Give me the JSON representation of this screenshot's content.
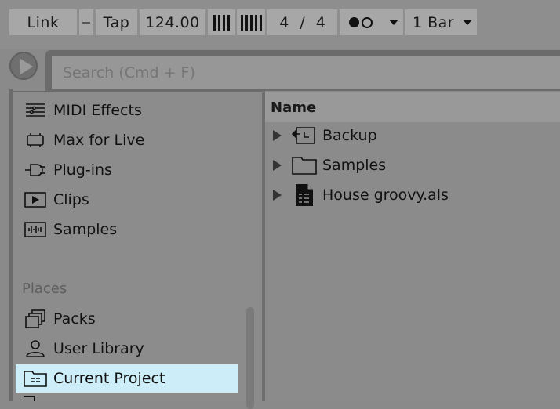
{
  "transport": {
    "link": "Link",
    "tap": "Tap",
    "tempo": "124.00",
    "meter_num": "4",
    "meter_sep": "/",
    "meter_den": "4",
    "quantize": "1 Bar"
  },
  "search": {
    "placeholder": "Search (Cmd + F)"
  },
  "sidebar": {
    "categories": [
      {
        "label": "MIDI Effects",
        "icon": "midi-effects-icon"
      },
      {
        "label": "Max for Live",
        "icon": "max-for-live-icon"
      },
      {
        "label": "Plug-ins",
        "icon": "plugins-icon"
      },
      {
        "label": "Clips",
        "icon": "clips-icon"
      },
      {
        "label": "Samples",
        "icon": "samples-icon"
      }
    ],
    "places_heading": "Places",
    "places": [
      {
        "label": "Packs",
        "icon": "packs-icon"
      },
      {
        "label": "User Library",
        "icon": "user-library-icon"
      },
      {
        "label": "Current Project",
        "icon": "current-project-icon",
        "selected": true
      }
    ]
  },
  "browser": {
    "column_header": "Name",
    "rows": [
      {
        "label": "Backup",
        "icon": "backup-folder-icon"
      },
      {
        "label": "Samples",
        "icon": "folder-icon"
      },
      {
        "label": "House groovy.als",
        "icon": "live-set-file-icon"
      }
    ]
  },
  "colors": {
    "selection": "#cdeef8",
    "panel": "#8c8c8c",
    "header": "#999999"
  }
}
